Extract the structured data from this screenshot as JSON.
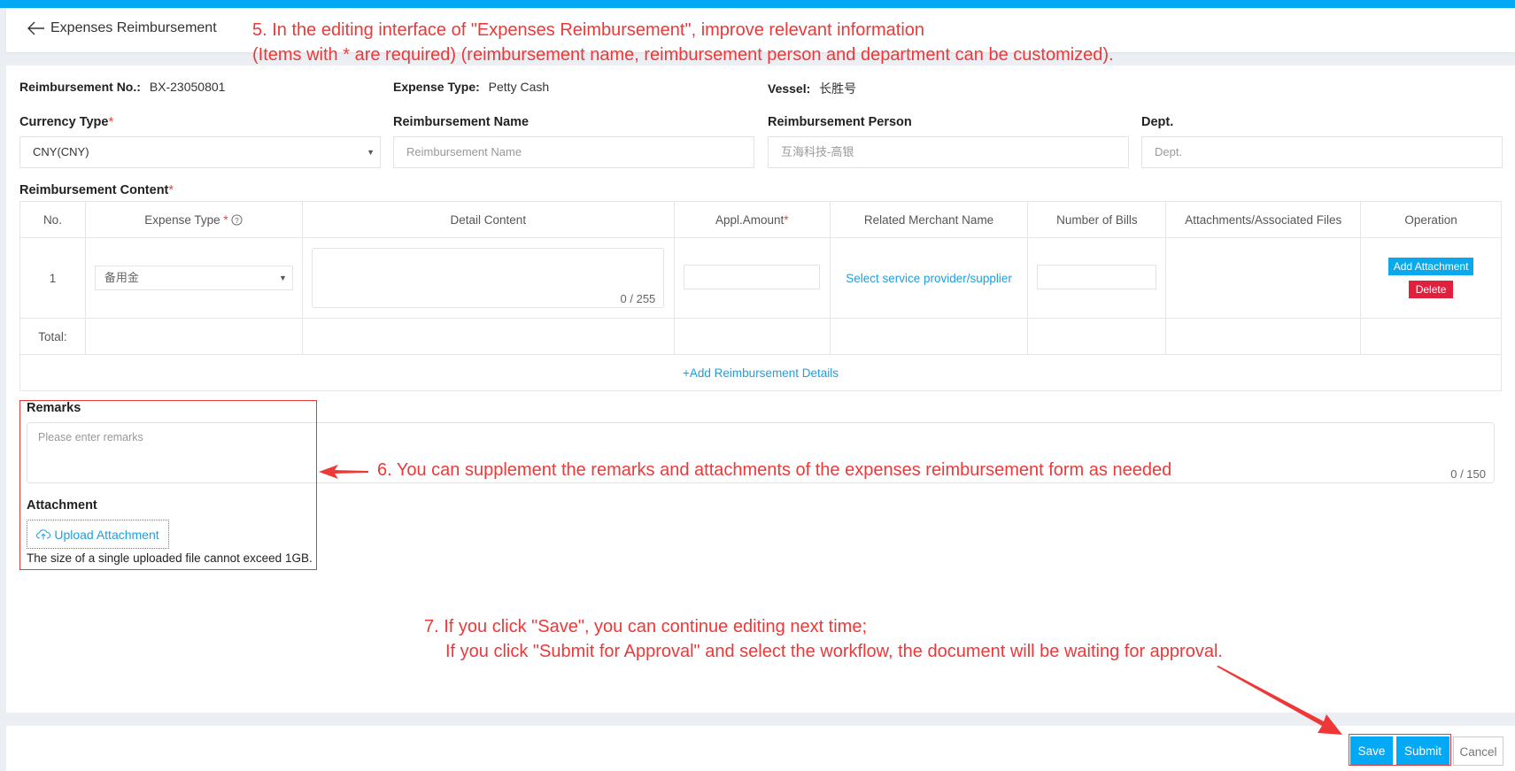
{
  "header": {
    "back_icon": "arrow-left-icon",
    "title": "Expenses Reimbursement"
  },
  "info": {
    "reimbursement_no_label": "Reimbursement No.:",
    "reimbursement_no_value": "BX-23050801",
    "expense_type_label": "Expense Type:",
    "expense_type_value": "Petty Cash",
    "vessel_label": "Vessel:",
    "vessel_value": "长胜号"
  },
  "fields": {
    "currency_type_label": "Currency Type",
    "currency_type_value": "CNY(CNY)",
    "reimbursement_name_label": "Reimbursement Name",
    "reimbursement_name_placeholder": "Reimbursement Name",
    "reimbursement_person_label": "Reimbursement Person",
    "reimbursement_person_value": "互海科技-高银",
    "dept_label": "Dept.",
    "dept_placeholder": "Dept.",
    "required_mark": "*"
  },
  "content": {
    "section_label": "Reimbursement Content",
    "columns": [
      "No.",
      "Expense Type",
      "Detail Content",
      "Appl.Amount",
      "Related Merchant Name",
      "Number of Bills",
      "Attachments/Associated Files",
      "Operation"
    ],
    "help_icon": "question-circle-icon",
    "rows": [
      {
        "no": "1",
        "expense_type": "备用金",
        "detail_counter": "0 / 255",
        "merchant_link": "Select service provider/supplier",
        "add_attachment": "Add Attachment",
        "delete": "Delete"
      }
    ],
    "total_label": "Total:",
    "add_details": "+Add Reimbursement Details"
  },
  "remarks": {
    "label": "Remarks",
    "placeholder": "Please enter remarks",
    "counter": "0 / 150"
  },
  "attachment": {
    "label": "Attachment",
    "upload_button": "Upload Attachment",
    "upload_icon": "cloud-upload-icon",
    "note": "The size of a single uploaded file cannot exceed 1GB."
  },
  "footer": {
    "save": "Save",
    "submit": "Submit",
    "cancel": "Cancel"
  },
  "annotations": {
    "step5_line1": "5. In the editing interface of \"Expenses Reimbursement\", improve relevant information",
    "step5_line2": "(Items with * are required) (reimbursement name, reimbursement person and department can be customized).",
    "step6": "6. You can supplement the remarks and attachments of the expenses reimbursement form as needed",
    "step7_line1": "7. If you click \"Save\", you can continue editing next time;",
    "step7_line2": "If you click \"Submit for Approval\" and select the workflow, the document will be waiting for approval."
  },
  "colors": {
    "accent": "#03a9f4",
    "link": "#1e9fe0",
    "danger": "#e0203c",
    "annotation": "#ee3838"
  }
}
